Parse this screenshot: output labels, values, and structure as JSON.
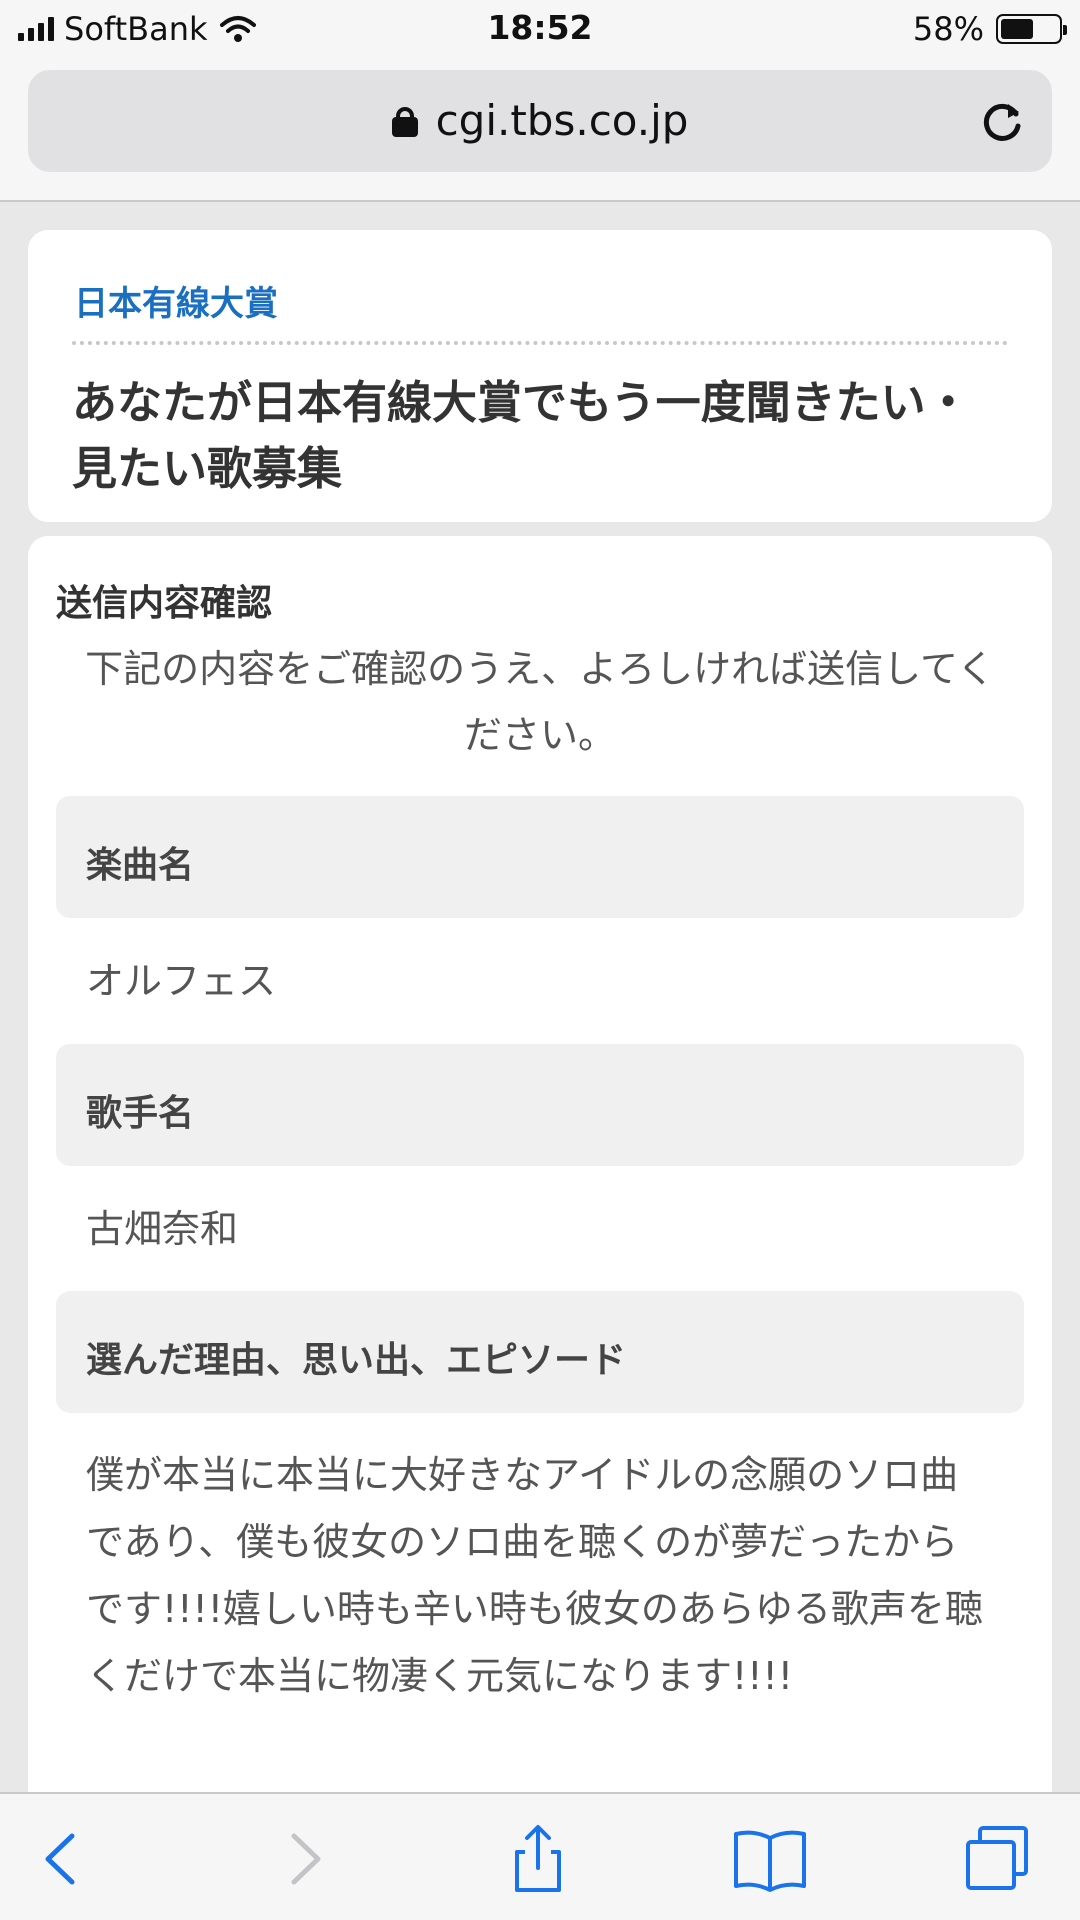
{
  "status_bar": {
    "carrier": "SoftBank",
    "time": "18:52",
    "battery": "58%",
    "battery_level": 0.58
  },
  "browser": {
    "url": "cgi.tbs.co.jp"
  },
  "header": {
    "site_name": "日本有線大賞",
    "title": "あなたが日本有線大賞でもう一度聞きたい・見たい歌募集"
  },
  "confirm": {
    "section_title": "送信内容確認",
    "instruction": "下記の内容をご確認のうえ、よろしければ送信してください。",
    "fields": [
      {
        "label": "楽曲名",
        "value": "オルフェス"
      },
      {
        "label": "歌手名",
        "value": "古畑奈和"
      },
      {
        "label": "選んだ理由、思い出、エピソード",
        "value": "僕が本当に本当に大好きなアイドルの念願のソロ曲であり、僕も彼女のソロ曲を聴くのが夢だったからです!!!!嬉しい時も辛い時も彼女のあらゆる歌声を聴くだけで本当に物凄く元気になります!!!!"
      }
    ]
  },
  "colors": {
    "accent": "#1a6fc0",
    "toolbar_icon": "#1a73e8",
    "disabled_icon": "#c4c4c8"
  }
}
